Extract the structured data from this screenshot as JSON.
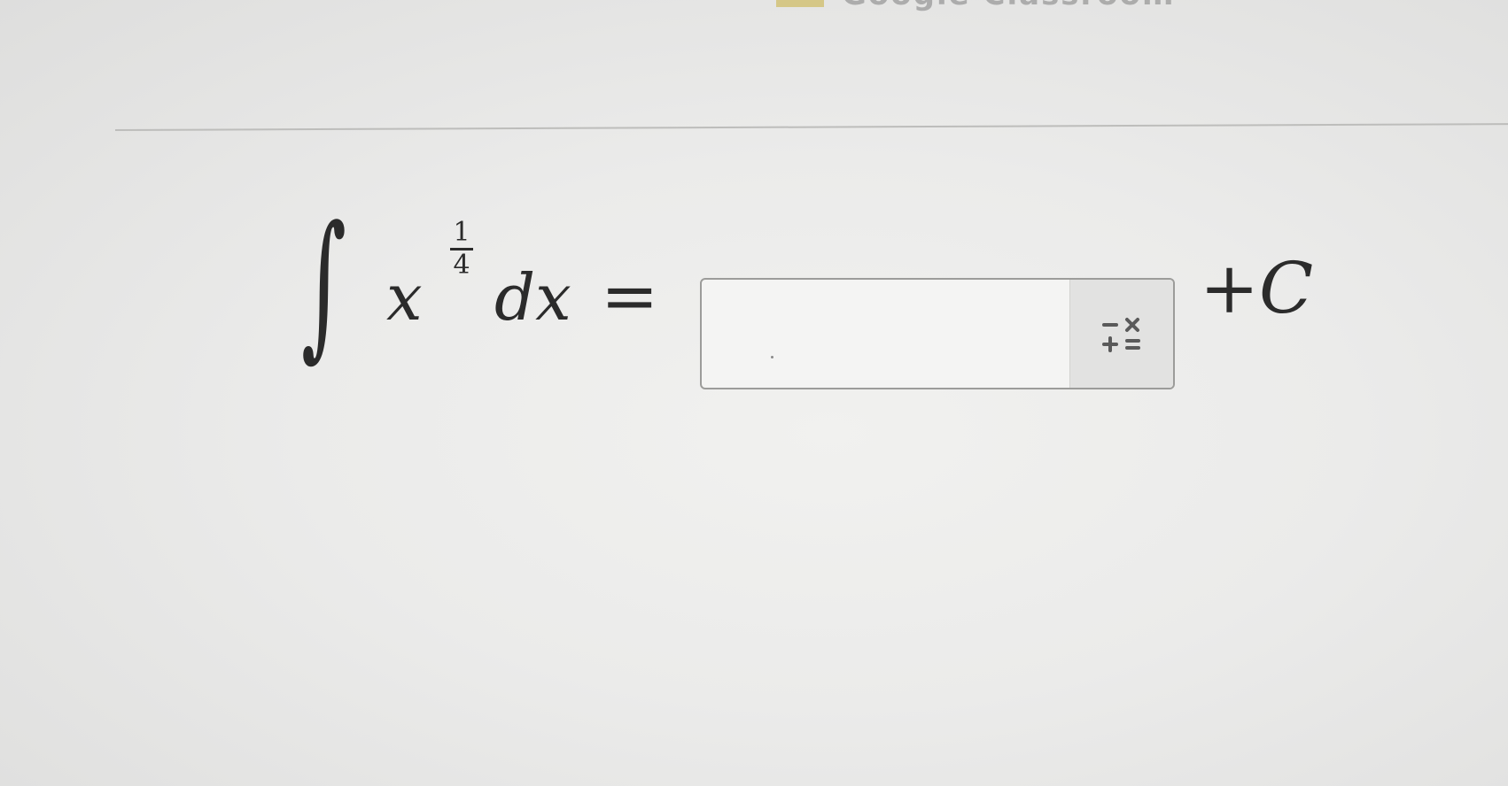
{
  "header": {
    "partial_text": "Google Classroom"
  },
  "question": {
    "integral_symbol": "∫",
    "variable": "x",
    "exponent_numerator": "1",
    "exponent_denominator": "4",
    "differential": "dx",
    "equals": "=",
    "constant": "+C",
    "constant_plus": "+",
    "constant_letter": "C"
  },
  "answer": {
    "value": "",
    "placeholder": ""
  },
  "keypad": {
    "icon": "math-keypad-icon",
    "glyph_color": "#5a5a5a"
  }
}
